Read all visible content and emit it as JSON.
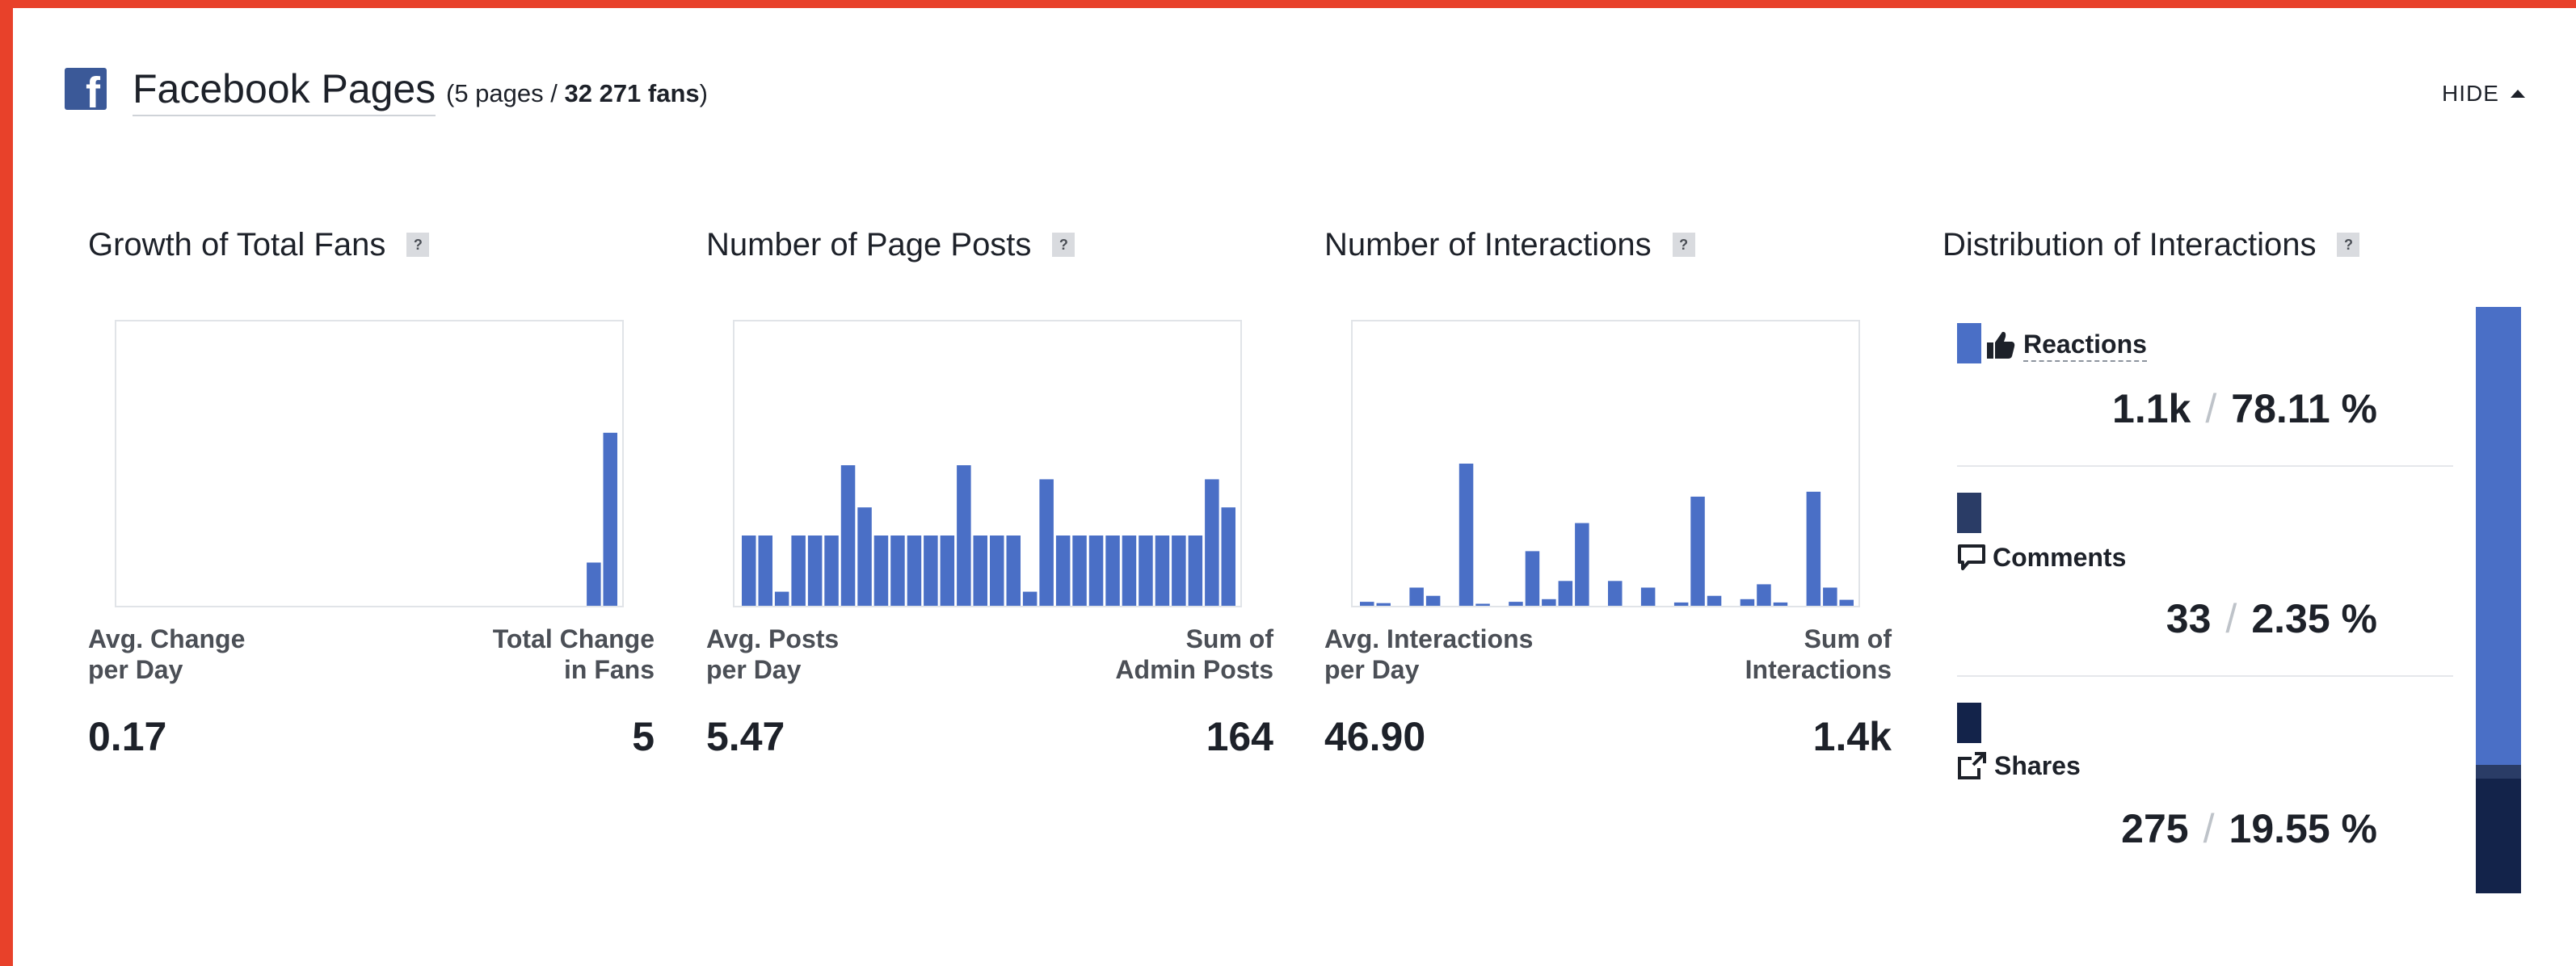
{
  "header": {
    "title": "Facebook Pages",
    "pages_text": "(5 pages / ",
    "fans_text": "32 271 fans",
    "close_paren": ")",
    "hide_label": "HIDE"
  },
  "metrics": [
    {
      "title": "Growth of Total Fans",
      "help": "?",
      "left_label": "Avg. Change\nper Day",
      "right_label": "Total Change\nin Fans",
      "left_value": "0.17",
      "right_value": "5"
    },
    {
      "title": "Number of Page Posts",
      "help": "?",
      "left_label": "Avg. Posts\nper Day",
      "right_label": "Sum of\nAdmin Posts",
      "left_value": "5.47",
      "right_value": "164"
    },
    {
      "title": "Number of Interactions",
      "help": "?",
      "left_label": "Avg. Interactions\nper Day",
      "right_label": "Sum of\nInteractions",
      "left_value": "46.90",
      "right_value": "1.4k"
    }
  ],
  "distribution": {
    "title": "Distribution of Interactions",
    "help": "?",
    "items": [
      {
        "name": "Reactions",
        "value": "1.1k",
        "percent": "78.11 %",
        "color": "#4a6fc6",
        "icon": "thumbs-up-icon"
      },
      {
        "name": "Comments",
        "value": "33",
        "percent": "2.35 %",
        "color": "#2a3c66",
        "icon": "comment-icon"
      },
      {
        "name": "Shares",
        "value": "275",
        "percent": "19.55 %",
        "color": "#13234a",
        "icon": "share-icon"
      }
    ],
    "separator": "/"
  },
  "chart_data": [
    {
      "type": "bar",
      "x": [
        1,
        2,
        3,
        4,
        5,
        6,
        7,
        8,
        9,
        10,
        11,
        12,
        13,
        14,
        15,
        16,
        17,
        18,
        19,
        20,
        21,
        22,
        23,
        24,
        25,
        26,
        27,
        28,
        29,
        30
      ],
      "values": [
        0,
        0,
        0,
        0,
        0,
        0,
        0,
        0,
        0,
        0,
        0,
        0,
        0,
        0,
        0,
        0,
        0,
        0,
        0,
        0,
        0,
        0,
        0,
        0,
        0,
        0,
        0,
        0,
        1,
        4
      ],
      "ylim": [
        0,
        6.5
      ],
      "color": "#4a6fc6"
    },
    {
      "type": "bar",
      "x": [
        1,
        2,
        3,
        4,
        5,
        6,
        7,
        8,
        9,
        10,
        11,
        12,
        13,
        14,
        15,
        16,
        17,
        18,
        19,
        20,
        21,
        22,
        23,
        24,
        25,
        26,
        27,
        28,
        29,
        30
      ],
      "values": [
        5,
        5,
        1,
        5,
        5,
        5,
        10,
        7,
        5,
        5,
        5,
        5,
        5,
        10,
        5,
        5,
        5,
        1,
        9,
        5,
        5,
        5,
        5,
        5,
        5,
        5,
        5,
        5,
        9,
        7
      ],
      "ylim": [
        0,
        20
      ],
      "color": "#4a6fc6"
    },
    {
      "type": "bar",
      "x": [
        1,
        2,
        3,
        4,
        5,
        6,
        7,
        8,
        9,
        10,
        11,
        12,
        13,
        14,
        15,
        16,
        17,
        18,
        19,
        20,
        21,
        22,
        23,
        24,
        25,
        26,
        27,
        28,
        29,
        30
      ],
      "values": [
        12,
        8,
        0,
        55,
        30,
        0,
        430,
        6,
        0,
        12,
        165,
        20,
        75,
        250,
        0,
        75,
        0,
        55,
        0,
        10,
        330,
        30,
        0,
        20,
        65,
        10,
        0,
        345,
        55,
        18
      ],
      "ylim": [
        0,
        850
      ],
      "color": "#4a6fc6"
    }
  ]
}
